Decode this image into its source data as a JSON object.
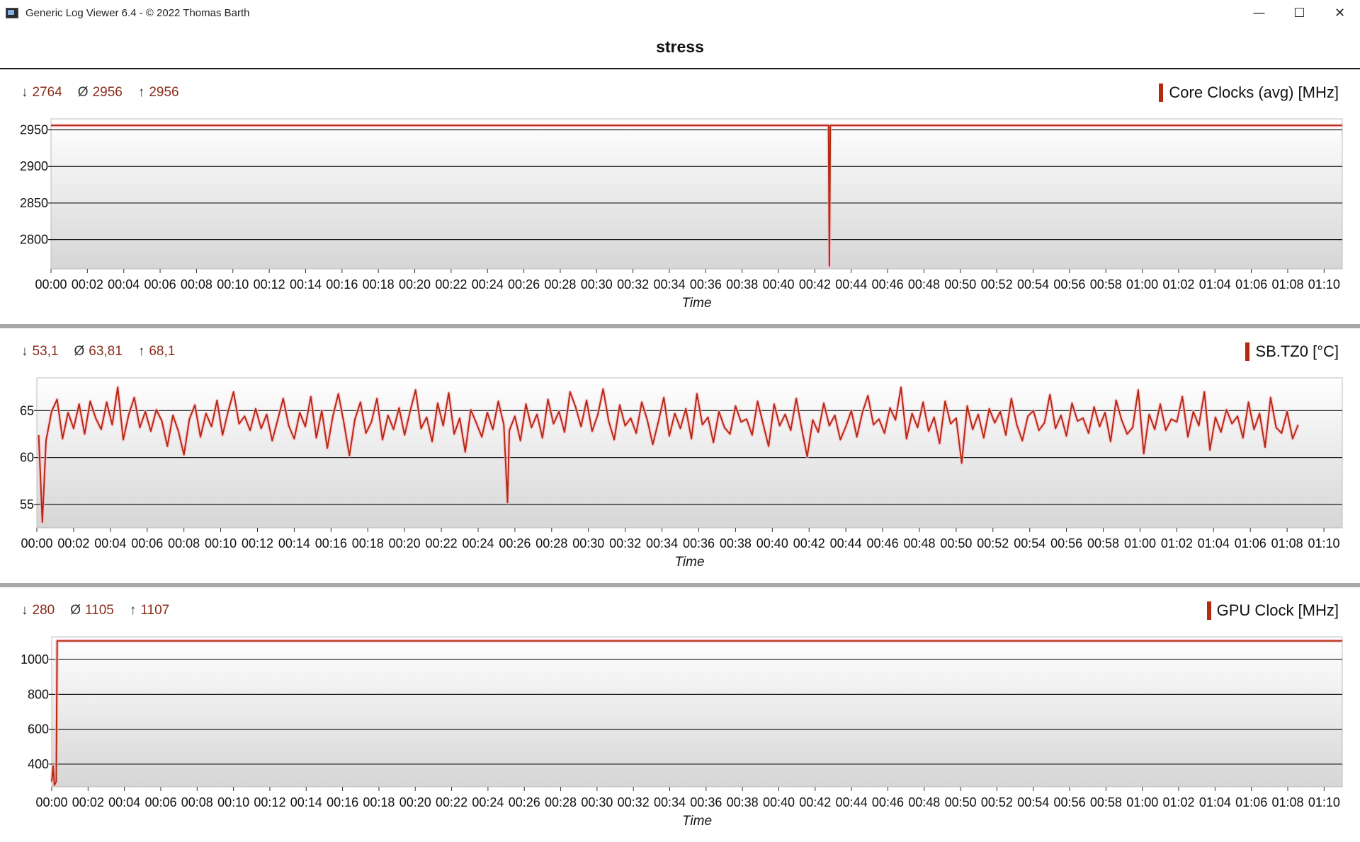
{
  "window": {
    "title": "Generic Log Viewer 6.4 - © 2022 Thomas Barth",
    "buttons": {
      "minimize": "—",
      "maximize": "☐",
      "close": "✕"
    }
  },
  "document_title": "stress",
  "colors": {
    "series": "#b52a10",
    "stat_text": "#8b2b1a",
    "separator": "#a8a8a8"
  },
  "panels": [
    {
      "series_name": "Core Clocks (avg) [MHz]",
      "stats": {
        "min_symbol": "↓",
        "min": "2764",
        "avg_symbol": "Ø",
        "avg": "2956",
        "max_symbol": "↑",
        "max": "2956"
      }
    },
    {
      "series_name": "SB.TZ0 [°C]",
      "stats": {
        "min_symbol": "↓",
        "min": "53,1",
        "avg_symbol": "Ø",
        "avg": "63,81",
        "max_symbol": "↑",
        "max": "68,1"
      }
    },
    {
      "series_name": "GPU Clock [MHz]",
      "stats": {
        "min_symbol": "↓",
        "min": "280",
        "avg_symbol": "Ø",
        "avg": "1105",
        "max_symbol": "↑",
        "max": "1107"
      }
    }
  ],
  "chart_data": [
    {
      "type": "line",
      "xlabel": "Time",
      "ylabel": "",
      "x_ticks": [
        "00:00",
        "00:02",
        "00:04",
        "00:06",
        "00:08",
        "00:10",
        "00:12",
        "00:14",
        "00:16",
        "00:18",
        "00:20",
        "00:22",
        "00:24",
        "00:26",
        "00:28",
        "00:30",
        "00:32",
        "00:34",
        "00:36",
        "00:38",
        "00:40",
        "00:42",
        "00:44",
        "00:46",
        "00:48",
        "00:50",
        "00:52",
        "00:54",
        "00:56",
        "00:58",
        "01:00",
        "01:02",
        "01:04",
        "01:06",
        "01:08",
        "01:10"
      ],
      "y_ticks": [
        2950,
        2900,
        2850,
        2800
      ],
      "ylim": [
        2760,
        2965
      ],
      "xlim_minutes": [
        0,
        71
      ],
      "grid": true,
      "series": [
        {
          "name": "Core Clocks (avg) [MHz]",
          "x_minutes": [
            0,
            42.75,
            42.8,
            42.85,
            71
          ],
          "values": [
            2956,
            2956,
            2764,
            2956,
            2956
          ]
        }
      ]
    },
    {
      "type": "line",
      "xlabel": "Time",
      "ylabel": "",
      "x_ticks": [
        "00:00",
        "00:02",
        "00:04",
        "00:06",
        "00:08",
        "00:10",
        "00:12",
        "00:14",
        "00:16",
        "00:18",
        "00:20",
        "00:22",
        "00:24",
        "00:26",
        "00:28",
        "00:30",
        "00:32",
        "00:34",
        "00:36",
        "00:38",
        "00:40",
        "00:42",
        "00:44",
        "00:46",
        "00:48",
        "00:50",
        "00:52",
        "00:54",
        "00:56",
        "00:58",
        "01:00",
        "01:02",
        "01:04",
        "01:06",
        "01:08",
        "01:10"
      ],
      "y_ticks": [
        65,
        60,
        55
      ],
      "ylim": [
        52.5,
        68.5
      ],
      "xlim_minutes": [
        0,
        71
      ],
      "grid": true,
      "series": [
        {
          "name": "SB.TZ0 [°C]",
          "x_minutes": [
            0.1,
            0.3,
            0.5,
            0.8,
            1.1,
            1.4,
            1.7,
            2.0,
            2.3,
            2.6,
            2.9,
            3.2,
            3.5,
            3.8,
            4.1,
            4.4,
            4.7,
            5.0,
            5.3,
            5.6,
            5.9,
            6.2,
            6.5,
            6.8,
            7.1,
            7.4,
            7.7,
            8.0,
            8.3,
            8.6,
            8.9,
            9.2,
            9.5,
            9.8,
            10.1,
            10.4,
            10.7,
            11.0,
            11.3,
            11.6,
            11.9,
            12.2,
            12.5,
            12.8,
            13.1,
            13.4,
            13.7,
            14.0,
            14.3,
            14.6,
            14.9,
            15.2,
            15.5,
            15.8,
            16.1,
            16.4,
            16.7,
            17.0,
            17.3,
            17.6,
            17.9,
            18.2,
            18.5,
            18.8,
            19.1,
            19.4,
            19.7,
            20.0,
            20.3,
            20.6,
            20.9,
            21.2,
            21.5,
            21.8,
            22.1,
            22.4,
            22.7,
            23.0,
            23.3,
            23.6,
            23.9,
            24.2,
            24.5,
            24.8,
            25.1,
            25.4,
            25.6,
            25.7,
            26.0,
            26.3,
            26.6,
            26.9,
            27.2,
            27.5,
            27.8,
            28.1,
            28.4,
            28.7,
            29.0,
            29.3,
            29.6,
            29.9,
            30.2,
            30.5,
            30.8,
            31.1,
            31.4,
            31.7,
            32.0,
            32.3,
            32.6,
            32.9,
            33.2,
            33.5,
            33.8,
            34.1,
            34.4,
            34.7,
            35.0,
            35.3,
            35.6,
            35.9,
            36.2,
            36.5,
            36.8,
            37.1,
            37.4,
            37.7,
            38.0,
            38.3,
            38.6,
            38.9,
            39.2,
            39.5,
            39.8,
            40.1,
            40.4,
            40.7,
            41.0,
            41.3,
            41.6,
            41.9,
            42.2,
            42.5,
            42.8,
            43.1,
            43.4,
            43.7,
            44.0,
            44.3,
            44.6,
            44.9,
            45.2,
            45.5,
            45.8,
            46.1,
            46.4,
            46.7,
            47.0,
            47.3,
            47.6,
            47.9,
            48.2,
            48.5,
            48.8,
            49.1,
            49.4,
            49.7,
            50.0,
            50.3,
            50.6,
            50.9,
            51.2,
            51.5,
            51.8,
            52.1,
            52.4,
            52.7,
            53.0,
            53.3,
            53.6,
            53.9,
            54.2,
            54.5,
            54.8,
            55.1,
            55.4,
            55.7,
            56.0,
            56.3,
            56.6,
            56.9,
            57.2,
            57.5,
            57.8,
            58.1,
            58.4,
            58.7,
            59.0,
            59.3,
            59.6,
            59.9,
            60.2,
            60.5,
            60.8,
            61.1,
            61.4,
            61.7,
            62.0,
            62.3,
            62.6,
            62.9,
            63.2,
            63.5,
            63.8,
            64.1,
            64.4,
            64.7,
            65.0,
            65.3,
            65.6,
            65.9,
            66.2,
            66.5,
            66.8,
            67.1,
            67.4,
            67.7,
            68.0,
            68.3,
            68.6,
            68.9,
            69.2,
            69.5,
            69.8,
            70.1,
            70.4,
            70.7
          ],
          "values": [
            62.4,
            53.1,
            61.8,
            64.9,
            66.2,
            62.0,
            64.8,
            63.1,
            65.7,
            62.5,
            66.0,
            64.2,
            63.0,
            65.9,
            63.5,
            67.5,
            61.9,
            64.6,
            66.4,
            63.2,
            64.9,
            62.8,
            65.1,
            63.9,
            61.2,
            64.5,
            62.8,
            60.3,
            64.1,
            65.6,
            62.2,
            64.7,
            63.3,
            66.1,
            62.4,
            64.9,
            67.0,
            63.6,
            64.4,
            62.9,
            65.2,
            63.1,
            64.6,
            61.8,
            64.0,
            66.3,
            63.4,
            62.0,
            64.8,
            63.3,
            66.5,
            62.1,
            65.0,
            61.0,
            64.4,
            66.8,
            63.7,
            60.2,
            64.1,
            65.9,
            62.6,
            63.8,
            66.3,
            61.9,
            64.5,
            63.0,
            65.3,
            62.4,
            64.9,
            67.2,
            63.1,
            64.3,
            61.7,
            65.8,
            63.4,
            66.9,
            62.5,
            64.2,
            60.6,
            65.1,
            63.7,
            62.2,
            64.8,
            63.0,
            66.0,
            63.5,
            55.2,
            62.9,
            64.4,
            61.8,
            65.7,
            63.2,
            64.6,
            62.1,
            66.2,
            63.6,
            64.9,
            62.7,
            67.0,
            65.4,
            63.3,
            66.1,
            62.8,
            64.5,
            67.3,
            63.9,
            61.9,
            65.6,
            63.4,
            64.2,
            62.6,
            65.9,
            64.0,
            61.4,
            63.8,
            66.4,
            62.3,
            64.7,
            63.1,
            65.2,
            62.0,
            66.8,
            63.5,
            64.3,
            61.6,
            64.9,
            63.2,
            62.5,
            65.5,
            63.8,
            64.1,
            62.4,
            66.0,
            63.6,
            61.2,
            65.7,
            63.4,
            64.6,
            62.9,
            66.3,
            63.1,
            60.1,
            64.0,
            62.7,
            65.8,
            63.4,
            64.5,
            61.9,
            63.3,
            65.0,
            62.2,
            64.8,
            66.6,
            63.5,
            64.1,
            62.6,
            65.3,
            64.0,
            67.5,
            62.0,
            64.7,
            63.2,
            65.9,
            62.8,
            64.3,
            61.5,
            66.0,
            63.6,
            64.2,
            59.4,
            65.5,
            63.0,
            64.6,
            62.1,
            65.2,
            63.7,
            64.9,
            62.4,
            66.3,
            63.5,
            61.8,
            64.4,
            65.0,
            62.9,
            63.7,
            66.7,
            63.1,
            64.5,
            62.3,
            65.8,
            63.9,
            64.2,
            62.6,
            65.4,
            63.3,
            64.8,
            61.7,
            66.1,
            64.0,
            62.5,
            63.2,
            67.2,
            60.4,
            64.6,
            63.0,
            65.7,
            62.9,
            64.1,
            63.8,
            66.5,
            62.2,
            64.9,
            63.4,
            67.0,
            60.8,
            64.3,
            62.7,
            65.1,
            63.6,
            64.4,
            62.1,
            65.9,
            63.0,
            64.7,
            61.1,
            66.4,
            63.2,
            62.6,
            64.9,
            62.0,
            63.5
          ]
        }
      ]
    },
    {
      "type": "line",
      "xlabel": "Time",
      "ylabel": "",
      "x_ticks": [
        "00:00",
        "00:02",
        "00:04",
        "00:06",
        "00:08",
        "00:10",
        "00:12",
        "00:14",
        "00:16",
        "00:18",
        "00:20",
        "00:22",
        "00:24",
        "00:26",
        "00:28",
        "00:30",
        "00:32",
        "00:34",
        "00:36",
        "00:38",
        "00:40",
        "00:42",
        "00:44",
        "00:46",
        "00:48",
        "00:50",
        "00:52",
        "00:54",
        "00:56",
        "00:58",
        "01:00",
        "01:02",
        "01:04",
        "01:06",
        "01:08",
        "01:10"
      ],
      "y_ticks": [
        1000,
        800,
        600,
        400
      ],
      "ylim": [
        270,
        1130
      ],
      "xlim_minutes": [
        0,
        71
      ],
      "grid": true,
      "series": [
        {
          "name": "GPU Clock [MHz]",
          "x_minutes": [
            0,
            0.08,
            0.15,
            0.25,
            0.3,
            71
          ],
          "values": [
            300,
            390,
            280,
            300,
            1107,
            1107
          ]
        }
      ]
    }
  ]
}
